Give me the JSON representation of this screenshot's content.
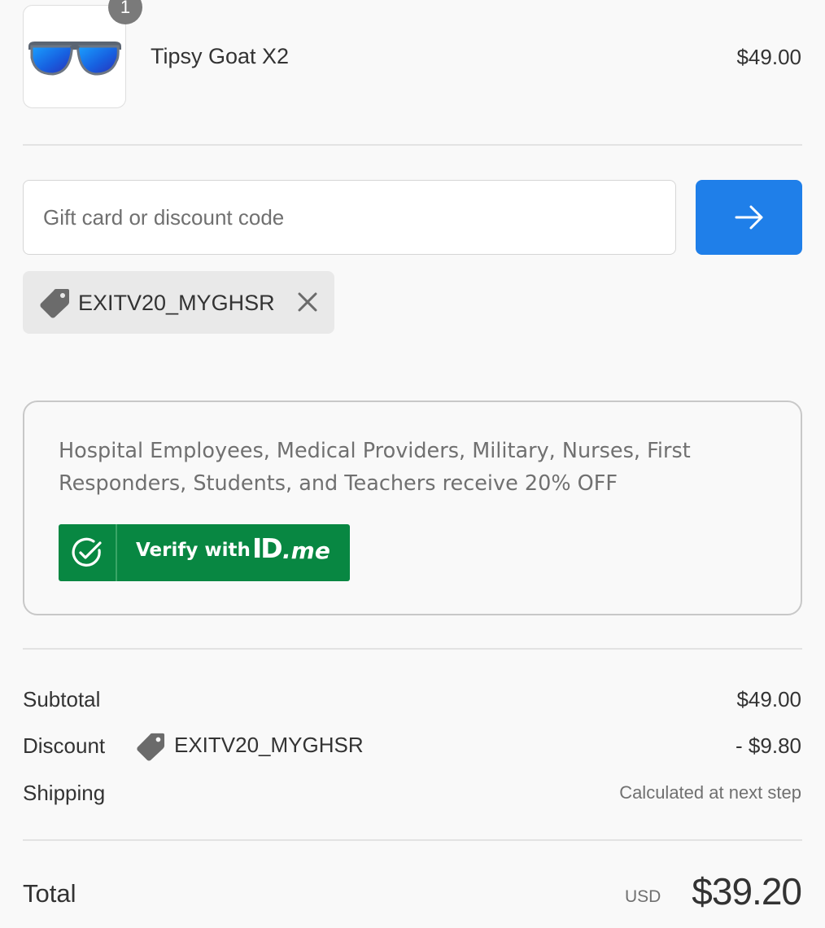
{
  "product": {
    "name": "Tipsy Goat X2",
    "price": "$49.00",
    "quantity": "1",
    "image_icon": "sunglasses-icon"
  },
  "discount": {
    "placeholder": "Gift card or discount code",
    "value": "",
    "apply_icon": "arrow-right-icon",
    "applied_code": "EXITV20_MYGHSR",
    "remove_icon": "close-icon",
    "tag_icon": "tag-icon"
  },
  "idme": {
    "message": "Hospital Employees, Medical Providers, Military, Nurses, First Responders, Students, and Teachers receive 20% OFF",
    "button_label": "Verify with",
    "logo_id": "ID",
    "logo_me": ".me",
    "button_color": "#088742"
  },
  "summary": {
    "subtotal_label": "Subtotal",
    "subtotal_value": "$49.00",
    "discount_label": "Discount",
    "discount_code": "EXITV20_MYGHSR",
    "discount_value": "- $9.80",
    "shipping_label": "Shipping",
    "shipping_value": "Calculated at next step",
    "total_label": "Total",
    "total_currency": "USD",
    "total_value": "$39.20"
  },
  "colors": {
    "accent": "#1f7fe9",
    "idme_green": "#088742",
    "background": "#f9f9f9"
  }
}
